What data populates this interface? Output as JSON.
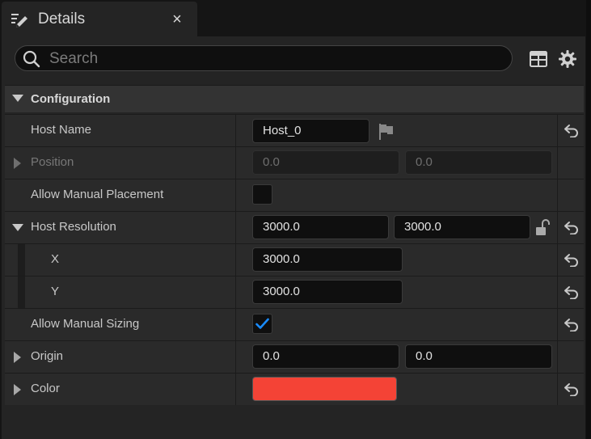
{
  "tab": {
    "title": "Details",
    "close_glyph": "×",
    "icon": "details-edit-icon"
  },
  "search": {
    "placeholder": "Search",
    "value": ""
  },
  "toolbar": {
    "table_icon": "table-view-icon",
    "settings_icon": "gear-icon"
  },
  "category": {
    "title": "Configuration",
    "expanded": true
  },
  "properties": {
    "host_name": {
      "label": "Host Name",
      "value": "Host_0"
    },
    "position": {
      "label": "Position",
      "x": "0.0",
      "y": "0.0",
      "enabled": false
    },
    "allow_manual_placement": {
      "label": "Allow Manual Placement",
      "checked": false
    },
    "host_resolution": {
      "label": "Host Resolution",
      "x": "3000.0",
      "y": "3000.0",
      "expanded": true
    },
    "res_x": {
      "label": "X",
      "value": "3000.0"
    },
    "res_y": {
      "label": "Y",
      "value": "3000.0"
    },
    "allow_manual_sizing": {
      "label": "Allow Manual Sizing",
      "checked": true
    },
    "origin": {
      "label": "Origin",
      "x": "0.0",
      "y": "0.0"
    },
    "color": {
      "label": "Color",
      "value": "#F44336"
    }
  },
  "colors": {
    "accent": "#1a8cff",
    "swatch": "#F44336"
  }
}
